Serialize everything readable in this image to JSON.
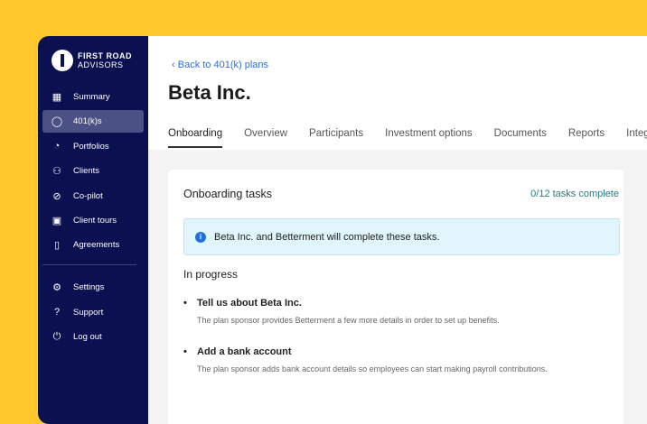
{
  "brand": {
    "line1": "FIRST ROAD",
    "line2": "ADVISORS"
  },
  "sidebar": {
    "items": [
      {
        "label": "Summary",
        "icon": "building-icon"
      },
      {
        "label": "401(k)s",
        "icon": "egg-icon",
        "active": true
      },
      {
        "label": "Portfolios",
        "icon": "pie-chart-icon"
      },
      {
        "label": "Clients",
        "icon": "users-icon"
      },
      {
        "label": "Co-pilot",
        "icon": "compass-icon"
      },
      {
        "label": "Client tours",
        "icon": "presentation-icon"
      },
      {
        "label": "Agreements",
        "icon": "document-icon"
      }
    ],
    "bottom": [
      {
        "label": "Settings",
        "icon": "gear-icon"
      },
      {
        "label": "Support",
        "icon": "help-icon"
      },
      {
        "label": "Log out",
        "icon": "power-icon"
      }
    ]
  },
  "header": {
    "back": "Back to 401(k) plans",
    "title": "Beta Inc."
  },
  "tabs": [
    "Onboarding",
    "Overview",
    "Participants",
    "Investment options",
    "Documents",
    "Reports",
    "Integrations"
  ],
  "card": {
    "title": "Onboarding tasks",
    "count": "0/12 tasks complete",
    "alert": "Beta Inc. and Betterment will complete these tasks.",
    "section": "In progress",
    "tasks": [
      {
        "title": "Tell us about Beta Inc.",
        "desc": "The plan sponsor provides Betterment a few more details in order to set up benefits."
      },
      {
        "title": "Add a bank account",
        "desc": "The plan sponsor adds bank account details so employees can start making payroll contributions."
      }
    ]
  }
}
